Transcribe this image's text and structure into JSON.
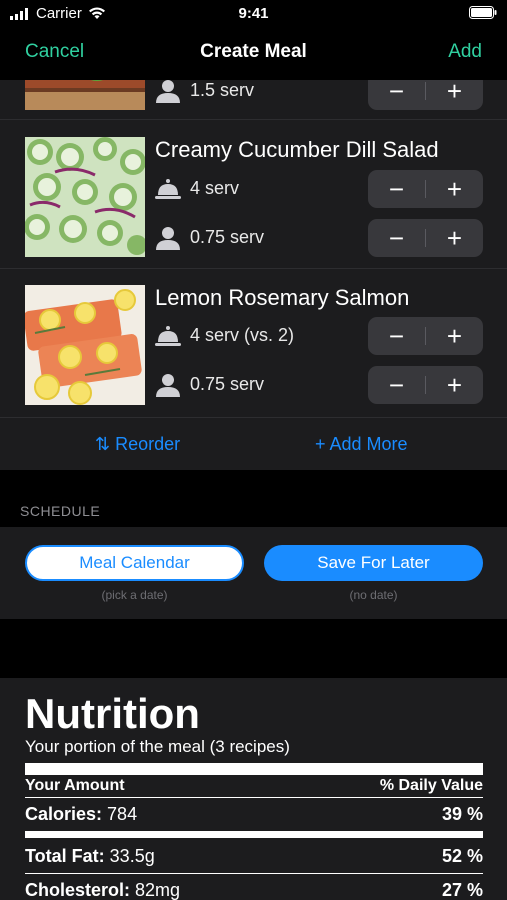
{
  "status_bar": {
    "carrier": "Carrier",
    "time": "9:41"
  },
  "nav": {
    "cancel": "Cancel",
    "title": "Create Meal",
    "add": "Add"
  },
  "recipes": [
    {
      "name": "",
      "lines": [
        {
          "icon": "person-icon",
          "text": "1.5 serv"
        }
      ]
    },
    {
      "name": "Creamy Cucumber Dill Salad",
      "lines": [
        {
          "icon": "serving-dish-icon",
          "text": "4 serv"
        },
        {
          "icon": "person-icon",
          "text": "0.75 serv"
        }
      ]
    },
    {
      "name": "Lemon Rosemary Salmon",
      "lines": [
        {
          "icon": "serving-dish-icon",
          "text": "4 serv (vs. 2)"
        },
        {
          "icon": "person-icon",
          "text": "0.75 serv"
        }
      ]
    }
  ],
  "stepper": {
    "minus": "−",
    "plus": "+"
  },
  "actions": {
    "reorder": "⇅ Reorder",
    "add_more": "+ Add More"
  },
  "schedule": {
    "header": "SCHEDULE",
    "calendar_button": "Meal Calendar",
    "calendar_sub": "(pick a date)",
    "save_button": "Save For Later",
    "save_sub": "(no date)"
  },
  "nutrition": {
    "title": "Nutrition",
    "subtitle": "Your portion of the meal (3 recipes)",
    "col_amount": "Your Amount",
    "col_daily": "% Daily Value",
    "rows": [
      {
        "label": "Calories:",
        "value": "784",
        "pct": "39 %"
      },
      {
        "label": "Total Fat:",
        "value": "33.5g",
        "pct": "52 %"
      },
      {
        "label": "Cholesterol:",
        "value": "82mg",
        "pct": "27 %"
      }
    ]
  },
  "colors": {
    "accent_green": "#30d0a0",
    "accent_blue": "#1a8cff",
    "card_bg": "#1c1c1e"
  }
}
